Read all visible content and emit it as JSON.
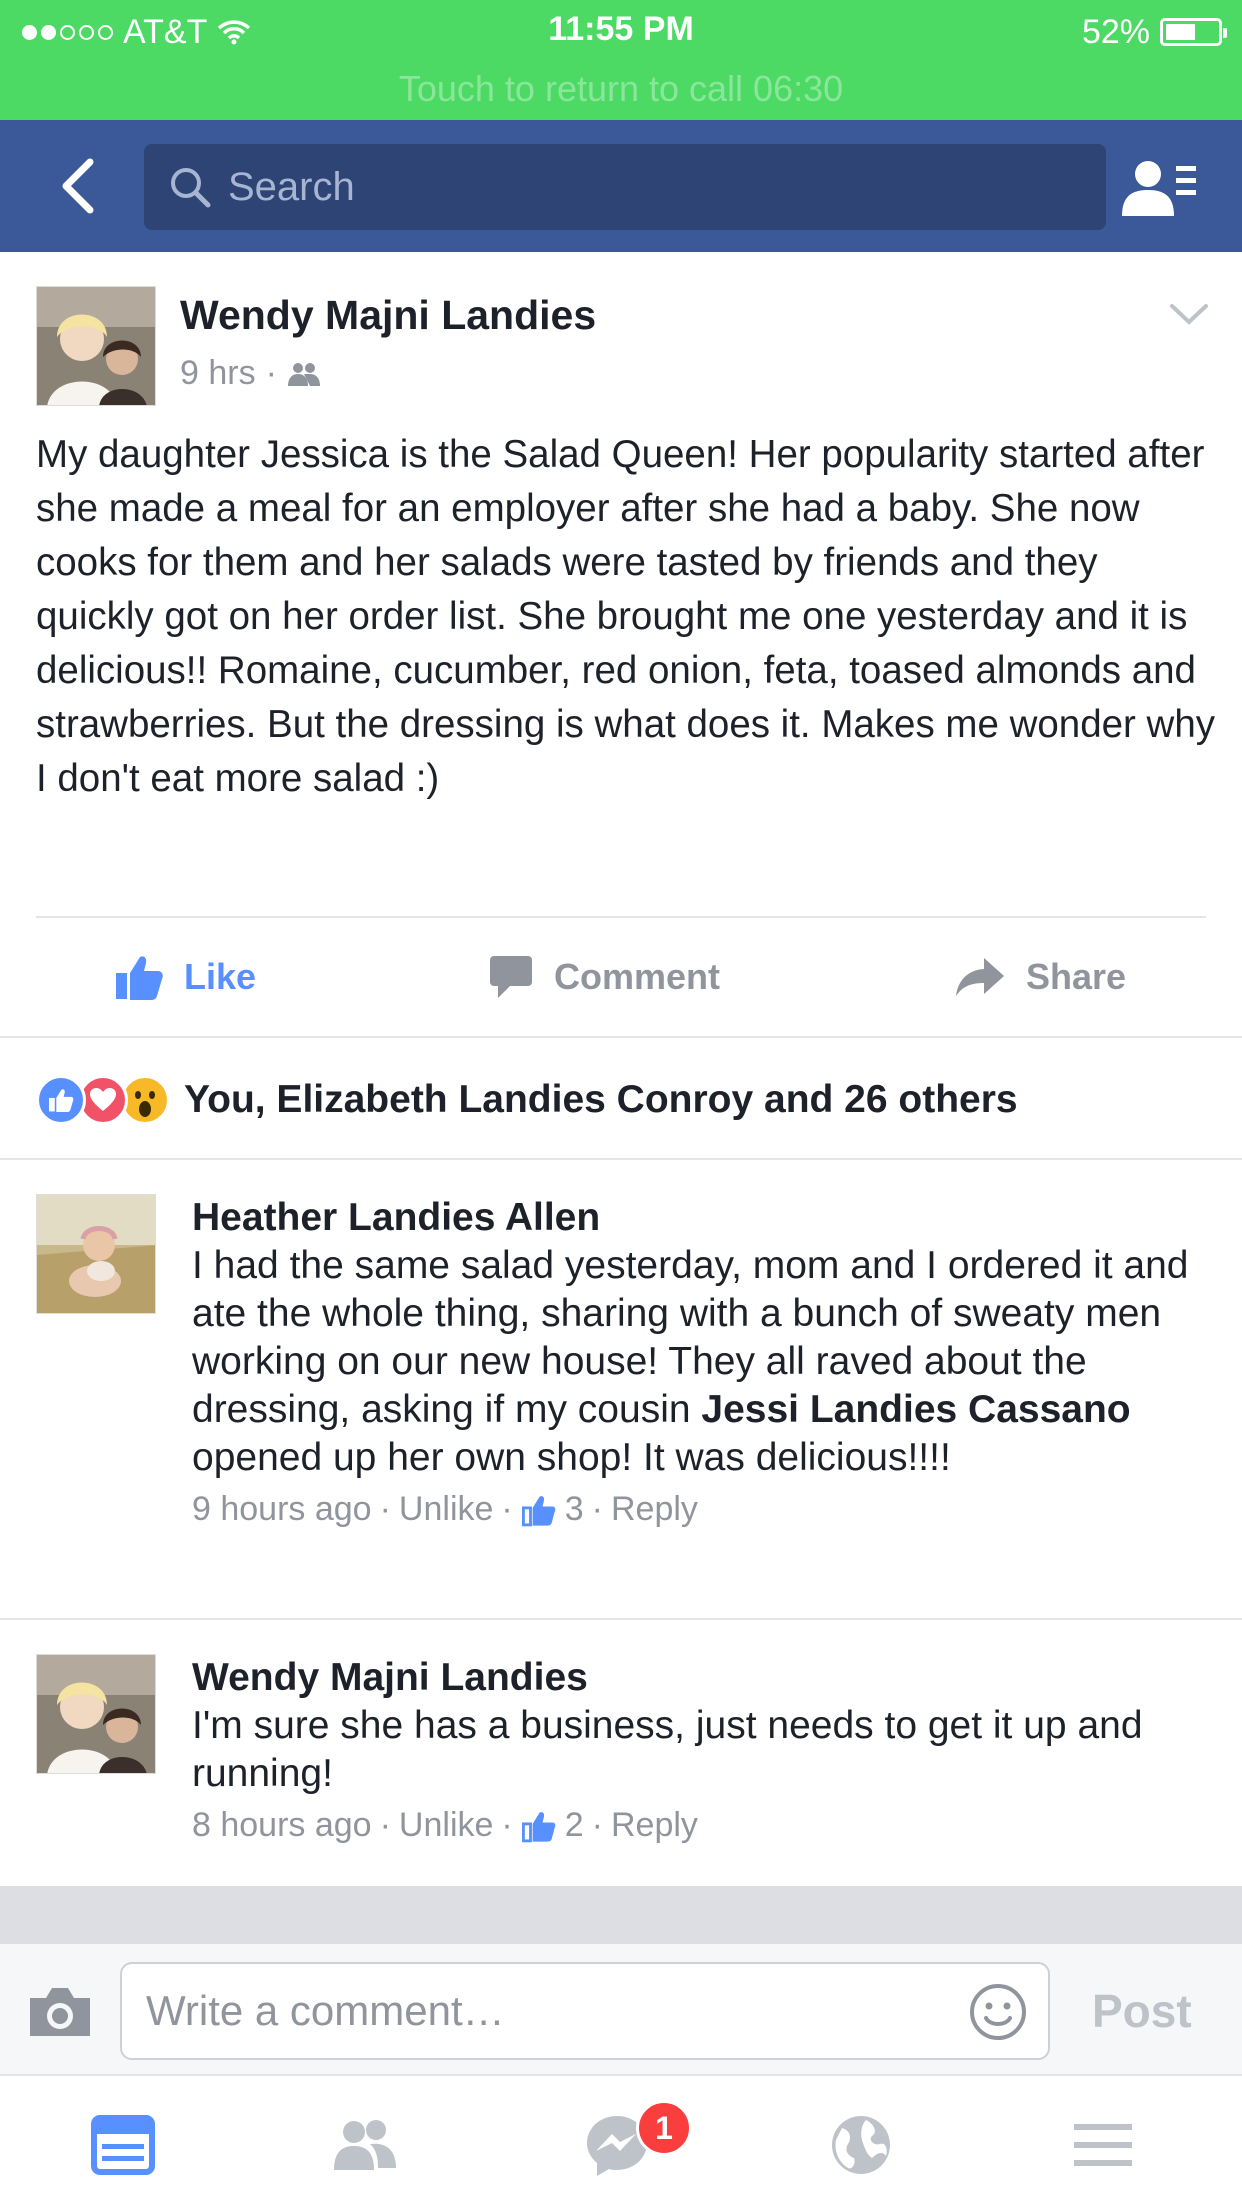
{
  "status_bar": {
    "carrier": "AT&T",
    "time": "11:55 PM",
    "battery": "52%",
    "call_banner": "Touch to return to call  06:30"
  },
  "navbar": {
    "search_placeholder": "Search"
  },
  "post": {
    "author": "Wendy Majni Landies",
    "time": "9 hrs",
    "audience_icon": "friends-icon",
    "text": "My daughter Jessica is the Salad Queen! Her popularity started after she made a meal for an employer after she had a baby. She now cooks for them and her salads were tasted by friends and they quickly got on her order list. She brought me one yesterday and it is delicious!! Romaine, cucumber, red onion, feta, toased almonds and strawberries. But the dressing is what does it. Makes me wonder why I don't eat more salad :)"
  },
  "actions": {
    "like": "Like",
    "comment": "Comment",
    "share": "Share"
  },
  "reactions": {
    "summary": "You, Elizabeth Landies Conroy and 26 others",
    "types": [
      "like",
      "love",
      "wow"
    ]
  },
  "comments": [
    {
      "name": "Heather Landies Allen",
      "text_before": "I had the same salad yesterday, mom and I ordered it and ate the whole thing, sharing with a bunch of sweaty men working on our new house! They all raved about the dressing, asking if my cousin ",
      "mention": "Jessi Landies Cassano",
      "text_after": " opened up her own shop! It was delicious!!!!",
      "time": "9 hours ago",
      "unlike": "Unlike",
      "likes": "3",
      "reply": "Reply"
    },
    {
      "name": "Wendy Majni Landies",
      "text_before": "I'm sure she has a business, just needs to get it up and running!",
      "mention": "",
      "text_after": "",
      "time": "8 hours ago",
      "unlike": "Unlike",
      "likes": "2",
      "reply": "Reply"
    }
  ],
  "composer": {
    "placeholder": "Write a comment…",
    "post": "Post"
  },
  "tabbar": {
    "messenger_badge": "1"
  },
  "colors": {
    "status_green": "#4cd964",
    "nav_blue": "#3b5998",
    "like_blue": "#5890ff",
    "love_red": "#f25268",
    "wow_yellow": "#f7b928"
  }
}
